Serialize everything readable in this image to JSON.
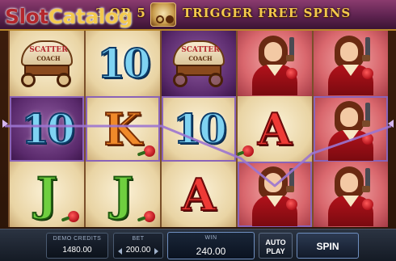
{
  "watermark": {
    "slot": "Slot",
    "catalog": "Catalog"
  },
  "banner": {
    "left_text": "3 OR 5",
    "right_text": "TRIGGER FREE SPINS",
    "scatter_icon": "scatter-coach-icon"
  },
  "reels": [
    [
      "scatter",
      "10",
      "J"
    ],
    [
      "10",
      "K",
      "J"
    ],
    [
      "scatter",
      "10",
      "A"
    ],
    [
      "lady",
      "A",
      "lady"
    ],
    [
      "lady",
      "lady",
      "lady"
    ]
  ],
  "scatter_symbol": {
    "label": "SCATTER",
    "sublabel": "COACH"
  },
  "symbols": {
    "ten": "10",
    "king": "K",
    "jack": "J",
    "ace": "A"
  },
  "panel": {
    "credits_label": "DEMO CREDITS",
    "credits_value": "1480.00",
    "bet_label": "BET",
    "bet_value": "200.00",
    "win_label": "WIN",
    "win_value": "240.00",
    "autoplay_line1": "AUTO",
    "autoplay_line2": "PLAY",
    "spin_label": "SPIN"
  },
  "colors": {
    "win_line": "#9b74d0",
    "banner_text": "#f3c94e"
  }
}
